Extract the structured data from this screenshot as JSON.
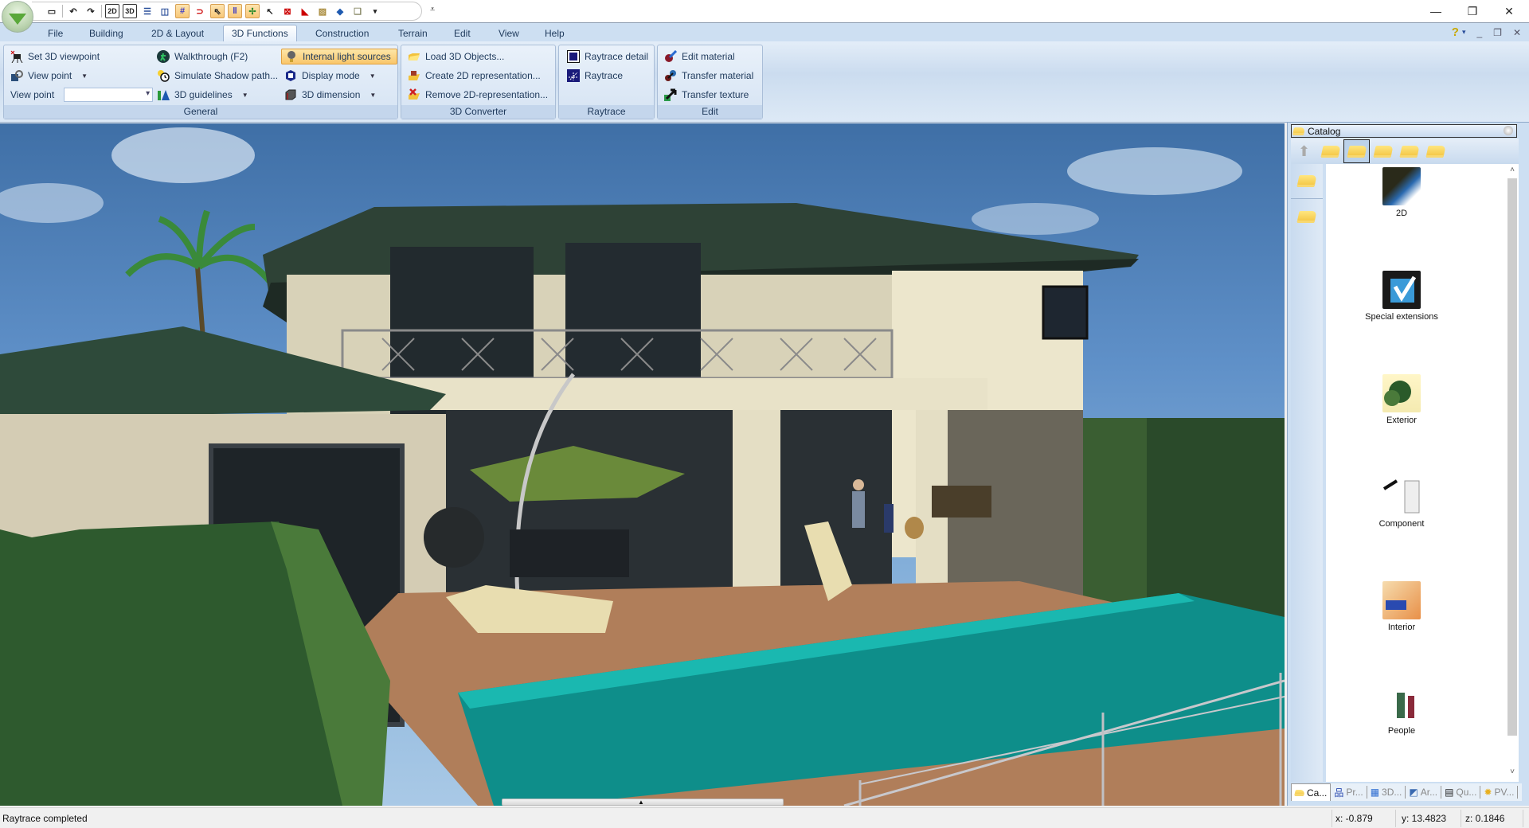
{
  "window": {
    "minimize_icon": "—",
    "restore_icon": "❐",
    "close_icon": "✕"
  },
  "quick_access": {
    "items": [
      {
        "name": "new-document-icon",
        "glyph": "▭"
      },
      {
        "name": "undo-icon",
        "glyph": "↶"
      },
      {
        "name": "redo-icon",
        "glyph": "↷"
      },
      {
        "name": "view-2d-icon",
        "glyph": "2D"
      },
      {
        "name": "view-3d-icon",
        "glyph": "3D"
      },
      {
        "name": "split-horizontal-icon",
        "glyph": "☰"
      },
      {
        "name": "split-vertical-icon",
        "glyph": "◫"
      },
      {
        "name": "grid-icon",
        "glyph": "#"
      },
      {
        "name": "magnet-icon",
        "glyph": "⊃"
      },
      {
        "name": "snap-pointer-icon",
        "glyph": "⇖"
      },
      {
        "name": "parallel-lines-icon",
        "glyph": "‖"
      },
      {
        "name": "crosshair-icon",
        "glyph": "✢"
      },
      {
        "name": "pointer-icon",
        "glyph": "↖"
      },
      {
        "name": "window-close-icon",
        "glyph": "⊠"
      },
      {
        "name": "flag-icon",
        "glyph": "◣"
      },
      {
        "name": "hatch-icon",
        "glyph": "▨"
      },
      {
        "name": "surface-icon",
        "glyph": "◆"
      },
      {
        "name": "copy-icon",
        "glyph": "❏"
      }
    ],
    "more_label": "⩡"
  },
  "tabs": [
    {
      "label": "File",
      "active": false
    },
    {
      "label": "Building",
      "active": false
    },
    {
      "label": "2D & Layout",
      "active": false
    },
    {
      "label": "3D Functions",
      "active": true
    },
    {
      "label": "Construction",
      "active": false
    },
    {
      "label": "Terrain",
      "active": false
    },
    {
      "label": "Edit",
      "active": false
    },
    {
      "label": "View",
      "active": false
    },
    {
      "label": "Help",
      "active": false
    }
  ],
  "help": {
    "help_icon": "?",
    "dropdown": "▾",
    "min": "_",
    "restore": "❐",
    "close": "✕"
  },
  "ribbon": {
    "general": {
      "label": "General",
      "set_viewpoint": "Set 3D viewpoint",
      "view_point_button": "View point",
      "view_point_label": "View point",
      "view_point_value": "",
      "walkthrough": "Walkthrough (F2)",
      "shadow_path": "Simulate Shadow path...",
      "guidelines": "3D guidelines",
      "internal_light": "Internal light sources",
      "display_mode": "Display mode",
      "dimension": "3D dimension"
    },
    "converter": {
      "label": "3D Converter",
      "load": "Load 3D Objects...",
      "create": "Create 2D representation...",
      "remove": "Remove 2D-representation..."
    },
    "raytrace": {
      "label": "Raytrace",
      "detail": "Raytrace detail",
      "raytrace": "Raytrace"
    },
    "edit": {
      "label": "Edit",
      "edit_material": "Edit material",
      "transfer_material": "Transfer material",
      "transfer_texture": "Transfer texture"
    }
  },
  "viewport": {
    "description": "Raytraced 3D render of a two-storey villa with pool, terrace, umbrella and hedges",
    "scroll_indicator": "▲"
  },
  "catalog": {
    "title": "Catalog",
    "items": [
      {
        "label": "2D"
      },
      {
        "label": "Special extensions"
      },
      {
        "label": "Exterior"
      },
      {
        "label": "Component"
      },
      {
        "label": "Interior"
      },
      {
        "label": "People"
      }
    ],
    "bottom_tabs": [
      {
        "label": "Ca...",
        "active": true
      },
      {
        "label": "Pr...",
        "active": false
      },
      {
        "label": "3D...",
        "active": false
      },
      {
        "label": "Ar...",
        "active": false
      },
      {
        "label": "Qu...",
        "active": false
      },
      {
        "label": "PV...",
        "active": false
      }
    ]
  },
  "status": {
    "message": "Raytrace completed",
    "x": "x: -0.879",
    "y": "y: 13.4823",
    "z": "z: 0.1846"
  },
  "colors": {
    "ribbon_bg": "#cddff2",
    "highlight": "#f9c66a",
    "text": "#1e395b"
  }
}
